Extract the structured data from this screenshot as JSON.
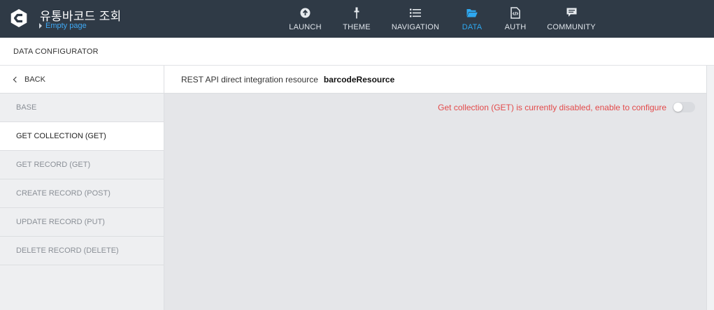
{
  "app": {
    "title": "유통바코드 조회",
    "page_link": "Empty page"
  },
  "nav": [
    {
      "label": "LAUNCH",
      "icon": "upload-circle-icon",
      "active": false
    },
    {
      "label": "THEME",
      "icon": "brush-icon",
      "active": false
    },
    {
      "label": "NAVIGATION",
      "icon": "list-icon",
      "active": false
    },
    {
      "label": "DATA",
      "icon": "folder-open-icon",
      "active": true
    },
    {
      "label": "AUTH",
      "icon": "code-file-icon",
      "active": false
    },
    {
      "label": "COMMUNITY",
      "icon": "chat-bubble-icon",
      "active": false
    }
  ],
  "subheader": {
    "title": "DATA CONFIGURATOR"
  },
  "sidebar": {
    "back_label": "BACK",
    "items": [
      {
        "label": "BASE",
        "active": false
      },
      {
        "label": "GET COLLECTION (GET)",
        "active": true
      },
      {
        "label": "GET RECORD (GET)",
        "active": false
      },
      {
        "label": "CREATE RECORD (POST)",
        "active": false
      },
      {
        "label": "UPDATE RECORD (PUT)",
        "active": false
      },
      {
        "label": "DELETE RECORD (DELETE)",
        "active": false
      }
    ]
  },
  "main": {
    "resource_prefix": "REST API direct integration resource",
    "resource_name": "barcodeResource",
    "notice": "Get collection (GET) is currently disabled, enable to configure",
    "toggle_enabled": false
  },
  "colors": {
    "topbar": "#2f3a46",
    "accent": "#2ea8f0",
    "warning": "#e34a4a"
  }
}
